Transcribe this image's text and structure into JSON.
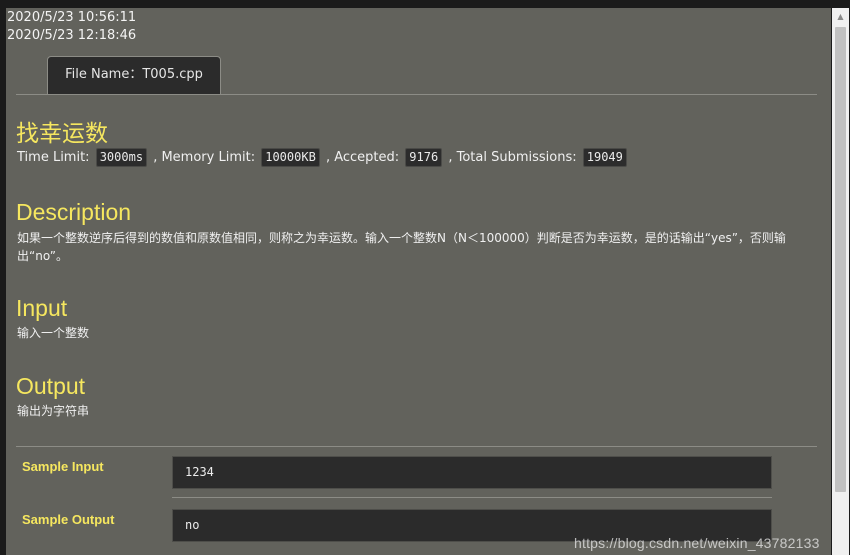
{
  "timestamps": {
    "first": "2020/5/23 10:56:11",
    "second": "2020/5/23 12:18:46"
  },
  "tab": {
    "label": "File Name：T005.cpp"
  },
  "problem": {
    "title": "找幸运数",
    "time_limit_label": "Time Limit:",
    "time_limit_value": "3000ms",
    "memory_limit_label": ", Memory Limit:",
    "memory_limit_value": "10000KB",
    "accepted_label": ", Accepted:",
    "accepted_value": "9176",
    "submissions_label": ", Total Submissions:",
    "submissions_value": "19049"
  },
  "sections": {
    "description_heading": "Description",
    "description_text": "如果一个整数逆序后得到的数值和原数值相同，则称之为幸运数。输入一个整数N（N＜100000）判断是否为幸运数，是的话输出“yes”，否则输出“no”。",
    "input_heading": "Input",
    "input_text": "输入一个整数",
    "output_heading": "Output",
    "output_text": "输出为字符串"
  },
  "samples": {
    "input_label": "Sample Input",
    "input_value": "1234",
    "output_label": "Sample Output",
    "output_value": "no"
  },
  "watermark": "https://blog.csdn.net/weixin_43782133",
  "colors": {
    "panel_bg": "#62625c",
    "heading_yellow": "#f6e75f",
    "dark_box": "#2b2b2b"
  }
}
